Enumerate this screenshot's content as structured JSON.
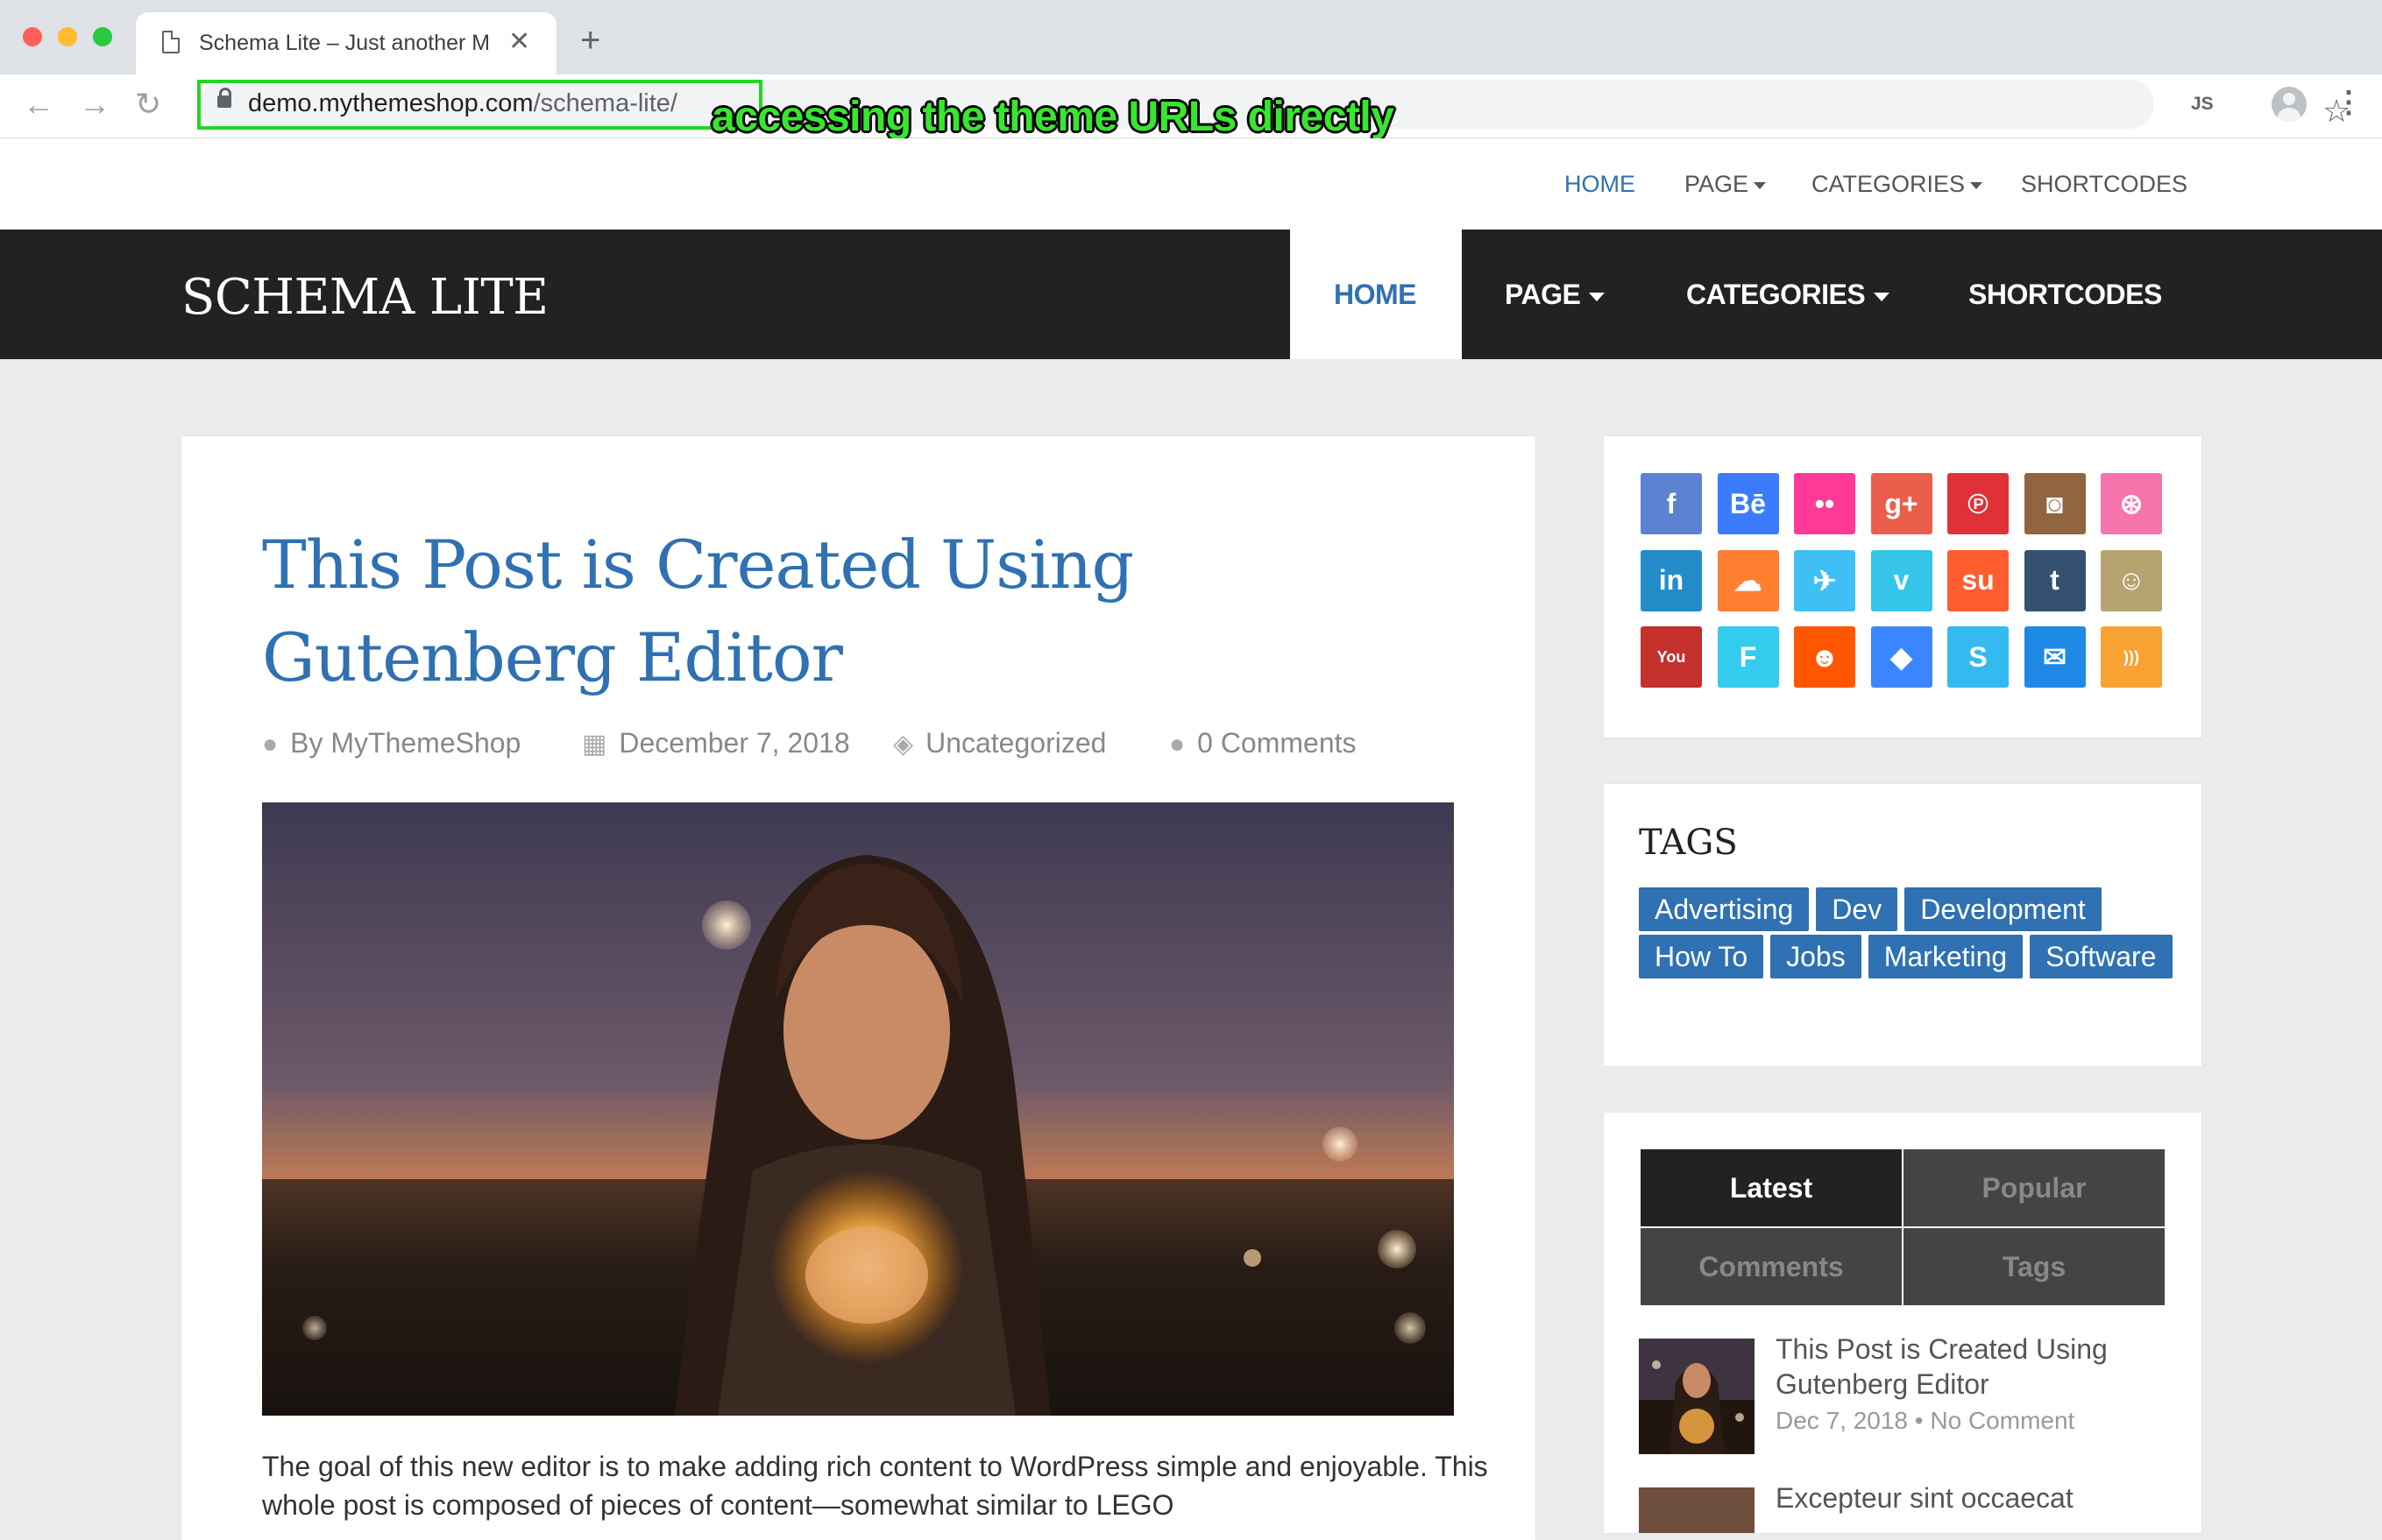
{
  "browser": {
    "tab_title": "Schema Lite – Just another My",
    "url_host": "demo.mythemeshop.com",
    "url_path": "/schema-lite/",
    "extension_label": "JS",
    "annotation": "accessing the theme URLs directly"
  },
  "topnav": {
    "items": [
      {
        "label": "HOME"
      },
      {
        "label": "PAGE"
      },
      {
        "label": "CATEGORIES"
      },
      {
        "label": "SHORTCODES"
      }
    ]
  },
  "header": {
    "logo": "SCHEMA LITE",
    "nav": [
      {
        "label": "HOME"
      },
      {
        "label": "PAGE"
      },
      {
        "label": "CATEGORIES"
      },
      {
        "label": "SHORTCODES"
      }
    ]
  },
  "post": {
    "title": "This Post is Created Using Gutenberg Editor",
    "author": "By MyThemeShop",
    "date": "December 7, 2018",
    "category": "Uncategorized",
    "comments": "0 Comments",
    "excerpt": "The goal of this new editor is to make adding rich content to WordPress simple and enjoyable. This whole post is composed of pieces of content—somewhat similar to LEGO"
  },
  "social": {
    "icons": [
      {
        "name": "facebook-icon",
        "glyph": "f",
        "color": "#5d82d1"
      },
      {
        "name": "behance-icon",
        "glyph": "Bē",
        "color": "#3b7cff"
      },
      {
        "name": "flickr-icon",
        "glyph": "••",
        "color": "#ff3998"
      },
      {
        "name": "google-plus-icon",
        "glyph": "g+",
        "color": "#eb5e4c"
      },
      {
        "name": "pinterest-icon",
        "glyph": "℗",
        "color": "#e13138"
      },
      {
        "name": "instagram-icon",
        "glyph": "◙",
        "color": "#91653f"
      },
      {
        "name": "dribbble-icon",
        "glyph": "⊛",
        "color": "#f773ac"
      },
      {
        "name": "linkedin-icon",
        "glyph": "in",
        "color": "#238cc8"
      },
      {
        "name": "soundcloud-icon",
        "glyph": "☁",
        "color": "#ff7e30"
      },
      {
        "name": "twitter-icon",
        "glyph": "✈",
        "color": "#40bff5"
      },
      {
        "name": "vimeo-icon",
        "glyph": "v",
        "color": "#35c6ea"
      },
      {
        "name": "stumbleupon-icon",
        "glyph": "su",
        "color": "#ff5c30"
      },
      {
        "name": "tumblr-icon",
        "glyph": "t",
        "color": "#34526f"
      },
      {
        "name": "github-icon",
        "glyph": "☺",
        "color": "#b6a470"
      },
      {
        "name": "youtube-icon",
        "glyph": "You",
        "color": "#c4302b"
      },
      {
        "name": "foursquare-icon",
        "glyph": "F",
        "color": "#34ccee"
      },
      {
        "name": "reddit-icon",
        "glyph": "☻",
        "color": "#ff5700"
      },
      {
        "name": "dropbox-icon",
        "glyph": "◆",
        "color": "#3b86ff"
      },
      {
        "name": "skype-icon",
        "glyph": "S",
        "color": "#34baf0"
      },
      {
        "name": "email-icon",
        "glyph": "✉",
        "color": "#1e88e5"
      },
      {
        "name": "rss-icon",
        "glyph": ")))",
        "color": "#f8a233"
      }
    ]
  },
  "tags": {
    "title": "TAGS",
    "items": [
      "Advertising",
      "Dev",
      "Development",
      "How To",
      "Jobs",
      "Marketing",
      "Software"
    ]
  },
  "tabs_widget": {
    "tabs": [
      "Latest",
      "Popular",
      "Comments",
      "Tags"
    ],
    "active": "Latest",
    "posts": [
      {
        "title": "This Post is Created Using Gutenberg Editor",
        "date": "Dec 7, 2018",
        "comments": "No Comment"
      },
      {
        "title": "Excepteur sint occaecat",
        "date": "",
        "comments": ""
      }
    ]
  },
  "colors": {
    "accent": "#2f71b2",
    "header_bg": "#222222",
    "annotation": "#37e62f"
  }
}
